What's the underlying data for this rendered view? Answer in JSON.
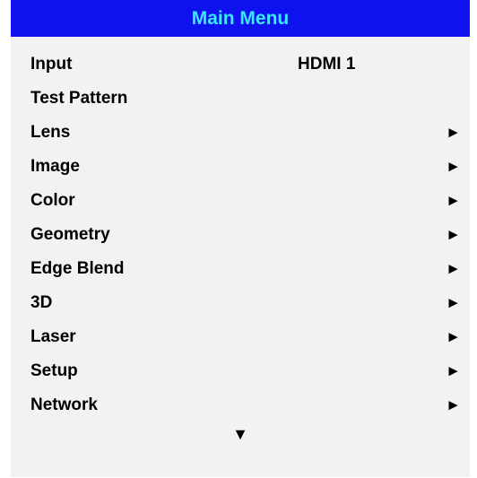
{
  "menu": {
    "title": "Main Menu",
    "colors": {
      "title_background": "#0d12ee",
      "title_text": "#39e9ff",
      "body_background": "#f2f2f2",
      "text": "#000000"
    },
    "items": [
      {
        "label": "Input",
        "value": "HDMI 1",
        "arrow": ""
      },
      {
        "label": "Test Pattern",
        "value": "",
        "arrow": ""
      },
      {
        "label": "Lens",
        "value": "",
        "arrow": "►"
      },
      {
        "label": "Image",
        "value": "",
        "arrow": "►"
      },
      {
        "label": "Color",
        "value": "",
        "arrow": "►"
      },
      {
        "label": "Geometry",
        "value": "",
        "arrow": "►"
      },
      {
        "label": "Edge Blend",
        "value": "",
        "arrow": "►"
      },
      {
        "label": "3D",
        "value": "",
        "arrow": "►"
      },
      {
        "label": "Laser",
        "value": "",
        "arrow": "►"
      },
      {
        "label": "Setup",
        "value": "",
        "arrow": "►"
      },
      {
        "label": "Network",
        "value": "",
        "arrow": "►"
      }
    ],
    "scroll_indicator": "▼"
  }
}
